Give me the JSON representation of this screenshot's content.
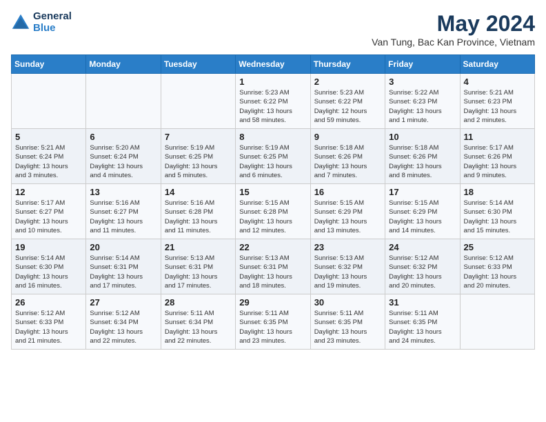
{
  "logo": {
    "line1": "General",
    "line2": "Blue"
  },
  "title": "May 2024",
  "subtitle": "Van Tung, Bac Kan Province, Vietnam",
  "days_of_week": [
    "Sunday",
    "Monday",
    "Tuesday",
    "Wednesday",
    "Thursday",
    "Friday",
    "Saturday"
  ],
  "weeks": [
    [
      {
        "day": "",
        "info": ""
      },
      {
        "day": "",
        "info": ""
      },
      {
        "day": "",
        "info": ""
      },
      {
        "day": "1",
        "info": "Sunrise: 5:23 AM\nSunset: 6:22 PM\nDaylight: 13 hours\nand 58 minutes."
      },
      {
        "day": "2",
        "info": "Sunrise: 5:23 AM\nSunset: 6:22 PM\nDaylight: 12 hours\nand 59 minutes."
      },
      {
        "day": "3",
        "info": "Sunrise: 5:22 AM\nSunset: 6:23 PM\nDaylight: 13 hours\nand 1 minute."
      },
      {
        "day": "4",
        "info": "Sunrise: 5:21 AM\nSunset: 6:23 PM\nDaylight: 13 hours\nand 2 minutes."
      }
    ],
    [
      {
        "day": "5",
        "info": "Sunrise: 5:21 AM\nSunset: 6:24 PM\nDaylight: 13 hours\nand 3 minutes."
      },
      {
        "day": "6",
        "info": "Sunrise: 5:20 AM\nSunset: 6:24 PM\nDaylight: 13 hours\nand 4 minutes."
      },
      {
        "day": "7",
        "info": "Sunrise: 5:19 AM\nSunset: 6:25 PM\nDaylight: 13 hours\nand 5 minutes."
      },
      {
        "day": "8",
        "info": "Sunrise: 5:19 AM\nSunset: 6:25 PM\nDaylight: 13 hours\nand 6 minutes."
      },
      {
        "day": "9",
        "info": "Sunrise: 5:18 AM\nSunset: 6:26 PM\nDaylight: 13 hours\nand 7 minutes."
      },
      {
        "day": "10",
        "info": "Sunrise: 5:18 AM\nSunset: 6:26 PM\nDaylight: 13 hours\nand 8 minutes."
      },
      {
        "day": "11",
        "info": "Sunrise: 5:17 AM\nSunset: 6:26 PM\nDaylight: 13 hours\nand 9 minutes."
      }
    ],
    [
      {
        "day": "12",
        "info": "Sunrise: 5:17 AM\nSunset: 6:27 PM\nDaylight: 13 hours\nand 10 minutes."
      },
      {
        "day": "13",
        "info": "Sunrise: 5:16 AM\nSunset: 6:27 PM\nDaylight: 13 hours\nand 11 minutes."
      },
      {
        "day": "14",
        "info": "Sunrise: 5:16 AM\nSunset: 6:28 PM\nDaylight: 13 hours\nand 11 minutes."
      },
      {
        "day": "15",
        "info": "Sunrise: 5:15 AM\nSunset: 6:28 PM\nDaylight: 13 hours\nand 12 minutes."
      },
      {
        "day": "16",
        "info": "Sunrise: 5:15 AM\nSunset: 6:29 PM\nDaylight: 13 hours\nand 13 minutes."
      },
      {
        "day": "17",
        "info": "Sunrise: 5:15 AM\nSunset: 6:29 PM\nDaylight: 13 hours\nand 14 minutes."
      },
      {
        "day": "18",
        "info": "Sunrise: 5:14 AM\nSunset: 6:30 PM\nDaylight: 13 hours\nand 15 minutes."
      }
    ],
    [
      {
        "day": "19",
        "info": "Sunrise: 5:14 AM\nSunset: 6:30 PM\nDaylight: 13 hours\nand 16 minutes."
      },
      {
        "day": "20",
        "info": "Sunrise: 5:14 AM\nSunset: 6:31 PM\nDaylight: 13 hours\nand 17 minutes."
      },
      {
        "day": "21",
        "info": "Sunrise: 5:13 AM\nSunset: 6:31 PM\nDaylight: 13 hours\nand 17 minutes."
      },
      {
        "day": "22",
        "info": "Sunrise: 5:13 AM\nSunset: 6:31 PM\nDaylight: 13 hours\nand 18 minutes."
      },
      {
        "day": "23",
        "info": "Sunrise: 5:13 AM\nSunset: 6:32 PM\nDaylight: 13 hours\nand 19 minutes."
      },
      {
        "day": "24",
        "info": "Sunrise: 5:12 AM\nSunset: 6:32 PM\nDaylight: 13 hours\nand 20 minutes."
      },
      {
        "day": "25",
        "info": "Sunrise: 5:12 AM\nSunset: 6:33 PM\nDaylight: 13 hours\nand 20 minutes."
      }
    ],
    [
      {
        "day": "26",
        "info": "Sunrise: 5:12 AM\nSunset: 6:33 PM\nDaylight: 13 hours\nand 21 minutes."
      },
      {
        "day": "27",
        "info": "Sunrise: 5:12 AM\nSunset: 6:34 PM\nDaylight: 13 hours\nand 22 minutes."
      },
      {
        "day": "28",
        "info": "Sunrise: 5:11 AM\nSunset: 6:34 PM\nDaylight: 13 hours\nand 22 minutes."
      },
      {
        "day": "29",
        "info": "Sunrise: 5:11 AM\nSunset: 6:35 PM\nDaylight: 13 hours\nand 23 minutes."
      },
      {
        "day": "30",
        "info": "Sunrise: 5:11 AM\nSunset: 6:35 PM\nDaylight: 13 hours\nand 23 minutes."
      },
      {
        "day": "31",
        "info": "Sunrise: 5:11 AM\nSunset: 6:35 PM\nDaylight: 13 hours\nand 24 minutes."
      },
      {
        "day": "",
        "info": ""
      }
    ]
  ]
}
